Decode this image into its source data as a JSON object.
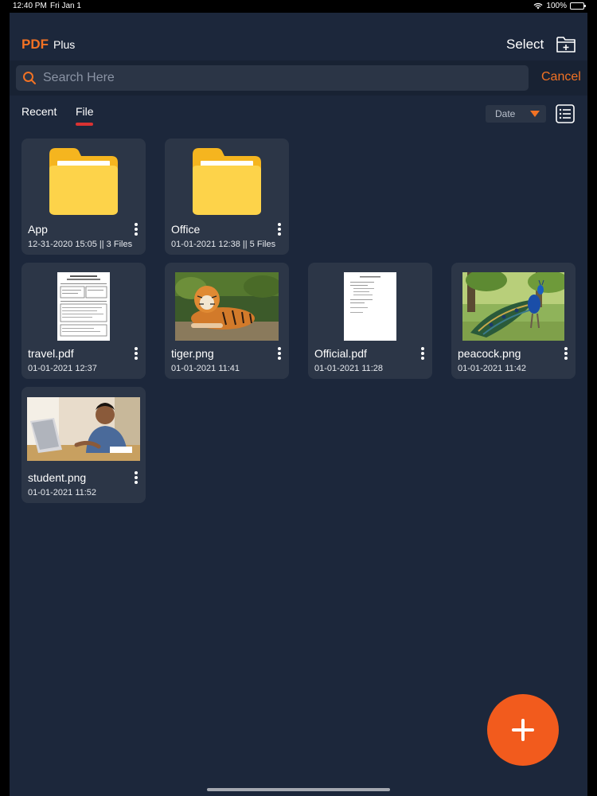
{
  "status_bar": {
    "time": "12:40 PM",
    "date": "Fri Jan 1",
    "battery": "100%"
  },
  "header": {
    "logo": "PDF",
    "logo_sub": "Plus",
    "select_label": "Select"
  },
  "search": {
    "placeholder": "Search Here",
    "cancel_label": "Cancel"
  },
  "tabs": {
    "recent": "Recent",
    "file": "File",
    "active": "File"
  },
  "sort": {
    "label": "Date"
  },
  "items": [
    {
      "name": "App",
      "meta": "12-31-2020 15:05 || 3 Files",
      "kind": "folder"
    },
    {
      "name": "Office",
      "meta": "01-01-2021 12:38 || 5 Files",
      "kind": "folder"
    },
    {
      "name": "travel.pdf",
      "meta": "01-01-2021 12:37",
      "kind": "pdf"
    },
    {
      "name": "tiger.png",
      "meta": "01-01-2021 11:41",
      "kind": "image"
    },
    {
      "name": "Official.pdf",
      "meta": "01-01-2021 11:28",
      "kind": "pdf"
    },
    {
      "name": "peacock.png",
      "meta": "01-01-2021 11:42",
      "kind": "image"
    },
    {
      "name": "student.png",
      "meta": "01-01-2021 11:52",
      "kind": "image"
    }
  ],
  "colors": {
    "accent": "#f27224",
    "background": "#1c273b",
    "card": "#2c3647",
    "fab": "#f25b1d",
    "tab_underline": "#d93232"
  },
  "icons": {
    "folder": "folder-icon",
    "new_folder": "new-folder-icon",
    "search": "search-icon",
    "list_view": "list-view-icon",
    "add": "plus-icon"
  }
}
